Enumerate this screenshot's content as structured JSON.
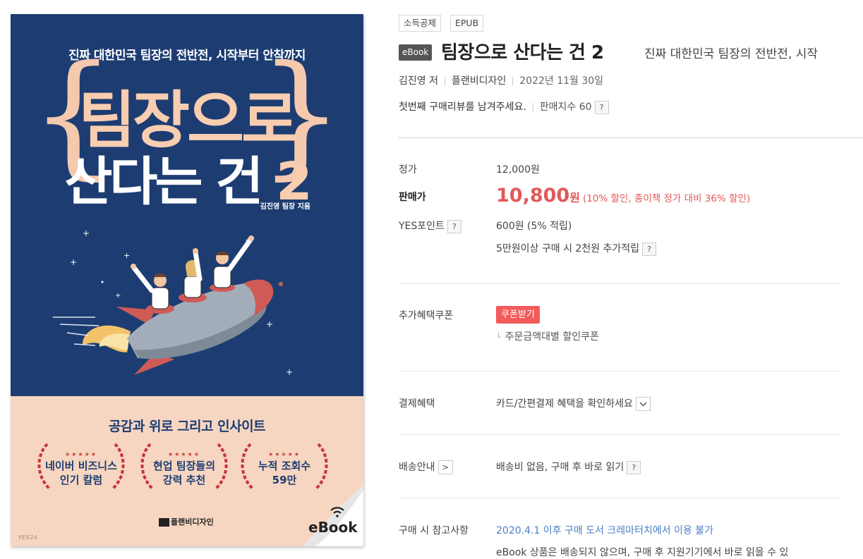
{
  "cover": {
    "subtitle": "진짜 대한민국 팀장의 전반전, 시작부터 안착까지",
    "title_line1": "팀장으로",
    "title_line2": "산다는 건",
    "title_number": "2",
    "author": "김진영 팀장 지음",
    "tagline": "공감과 위로 그리고 인사이트",
    "badges": [
      {
        "stars": "★★★★★",
        "text": "네이버 비즈니스\n인기 칼럼"
      },
      {
        "stars": "★★★★★",
        "text": "현업 팀장들의\n강력 추천"
      },
      {
        "stars": "★★★★★",
        "text": "누적 조회수\n59만"
      }
    ],
    "publisher": "플랜비디자인",
    "watermark": "YES24",
    "ebook_label": "eBook",
    "colors": {
      "navy": "#1d3d72",
      "peach": "#f6d6c1",
      "title_peach": "#f8cdb0",
      "rocket_red": "#d05a55"
    }
  },
  "info": {
    "tags": [
      "소득공제",
      "EPUB"
    ],
    "type_badge": "eBook",
    "title": "팀장으로 산다는 건 2",
    "subtitle": "진짜 대한민국 팀장의 전반전, 시작",
    "author": "김진영 저",
    "publisher": "플랜비디자인",
    "date": "2022년 11월 30일",
    "review_prompt": "첫번째 구매리뷰를 남겨주세요.",
    "sales_index": "판매지수 60",
    "help_mark": "?",
    "rows": {
      "list_price_label": "정가",
      "list_price": "12,000원",
      "sale_price_label": "판매가",
      "sale_price": "10,800",
      "sale_price_unit": "원",
      "discount": "(10% 할인, 종이책 정가 대비 36% 할인)",
      "point_label": "YES포인트",
      "point_value": "600원 (5% 적립)",
      "point_extra": "5만원이상 구매 시 2천원 추가적립",
      "coupon_label": "추가혜택쿠폰",
      "coupon_button": "쿠폰받기",
      "coupon_sub": "주문금액대별 할인쿠폰",
      "payment_label": "결제혜택",
      "payment_value": "카드/간편결제 혜택을 확인하세요",
      "delivery_label": "배송안내",
      "delivery_value": "배송비 없음, 구매 후 바로 읽기",
      "notes_label": "구매 시 참고사항",
      "notes_link": "2020.4.1 이후 구매 도서 크레마터치에서 이용 불가",
      "notes_text": "eBook 상품은 배송되지 않으며, 구매 후 지원기기에서 바로 읽을 수 있"
    },
    "colors": {
      "sale_red": "#e2595b",
      "coupon_red": "#f25b5b",
      "link_blue": "#4b7fc4"
    }
  }
}
